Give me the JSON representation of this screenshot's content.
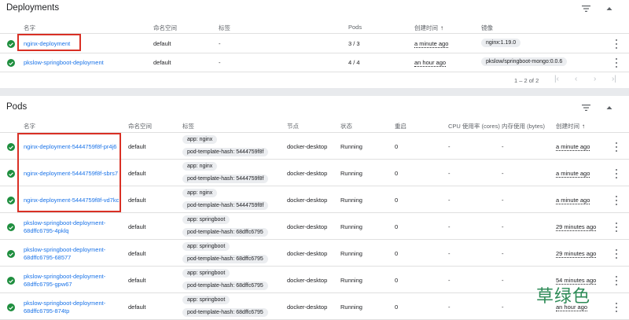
{
  "deployments": {
    "title": "Deployments",
    "columns": {
      "name": "名字",
      "namespace": "命名空间",
      "labels": "标签",
      "pods": "Pods",
      "created": "创建时间",
      "created_arrow": "↑",
      "images": "镜像"
    },
    "rows": [
      {
        "name": "nginx-deployment",
        "namespace": "default",
        "labels": "-",
        "pods": "3 / 3",
        "created": "a minute ago",
        "image": "nginx:1.19.0"
      },
      {
        "name": "pkslow-springboot-deployment",
        "namespace": "default",
        "labels": "-",
        "pods": "4 / 4",
        "created": "an hour ago",
        "image": "pkslow/springboot-mongo:0.0.6"
      }
    ],
    "pagination": "1 – 2 of 2"
  },
  "pods": {
    "title": "Pods",
    "columns": {
      "name": "名字",
      "namespace": "命名空间",
      "labels": "标签",
      "node": "节点",
      "status": "状态",
      "restarts": "重启",
      "cpu": "CPU 使用率 (cores)",
      "memory": "内存使用 (bytes)",
      "created": "创建时间",
      "created_arrow": "↑"
    },
    "rows": [
      {
        "name1": "nginx-deployment-5444759f8f-pr4j6",
        "name2": "",
        "namespace": "default",
        "label1": "app: nginx",
        "label2": "pod-template-hash: 5444759f8f",
        "node": "docker-desktop",
        "status": "Running",
        "restarts": "0",
        "cpu": "-",
        "memory": "-",
        "created": "a minute ago"
      },
      {
        "name1": "nginx-deployment-5444759f8f-sbrs7",
        "name2": "",
        "namespace": "default",
        "label1": "app: nginx",
        "label2": "pod-template-hash: 5444759f8f",
        "node": "docker-desktop",
        "status": "Running",
        "restarts": "0",
        "cpu": "-",
        "memory": "-",
        "created": "a minute ago"
      },
      {
        "name1": "nginx-deployment-5444759f8f-vd7kc",
        "name2": "",
        "namespace": "default",
        "label1": "app: nginx",
        "label2": "pod-template-hash: 5444759f8f",
        "node": "docker-desktop",
        "status": "Running",
        "restarts": "0",
        "cpu": "-",
        "memory": "-",
        "created": "a minute ago"
      },
      {
        "name1": "pkslow-springboot-deployment-",
        "name2": "68dffc6795-4pklq",
        "namespace": "default",
        "label1": "app: springboot",
        "label2": "pod-template-hash: 68dffc6795",
        "node": "docker-desktop",
        "status": "Running",
        "restarts": "0",
        "cpu": "-",
        "memory": "-",
        "created": "29 minutes ago"
      },
      {
        "name1": "pkslow-springboot-deployment-",
        "name2": "68dffc6795-68577",
        "namespace": "default",
        "label1": "app: springboot",
        "label2": "pod-template-hash: 68dffc6795",
        "node": "docker-desktop",
        "status": "Running",
        "restarts": "0",
        "cpu": "-",
        "memory": "-",
        "created": "29 minutes ago"
      },
      {
        "name1": "pkslow-springboot-deployment-",
        "name2": "68dffc6795-gpw67",
        "namespace": "default",
        "label1": "app: springboot",
        "label2": "pod-template-hash: 68dffc6795",
        "node": "docker-desktop",
        "status": "Running",
        "restarts": "0",
        "cpu": "-",
        "memory": "-",
        "created": "54 minutes ago"
      },
      {
        "name1": "pkslow-springboot-deployment-",
        "name2": "68dffc6795-874tp",
        "namespace": "default",
        "label1": "app: springboot",
        "label2": "pod-template-hash: 68dffc6795",
        "node": "docker-desktop",
        "status": "Running",
        "restarts": "0",
        "cpu": "-",
        "memory": "-",
        "created": "an hour ago"
      }
    ]
  },
  "watermark": "草绿色",
  "colors": {
    "link": "#1a73e8",
    "success": "#1e8e3e",
    "highlight": "#d93025",
    "watermark": "#2e8b57"
  },
  "icons": {
    "filter": "filter-icon",
    "collapse": "collapse-icon",
    "status": "check-circle-icon",
    "actions": "more-vert-icon"
  }
}
